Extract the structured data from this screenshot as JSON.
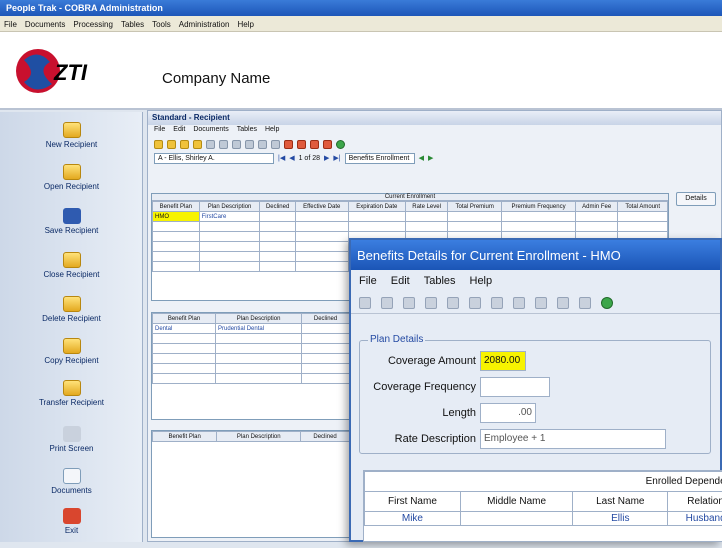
{
  "window": {
    "title": "People Trak - COBRA Administration"
  },
  "menubar": [
    "File",
    "Documents",
    "Processing",
    "Tables",
    "Tools",
    "Administration",
    "Help"
  ],
  "banner": {
    "logo_text": "ZTI",
    "company": "Company Name"
  },
  "sidebar": [
    {
      "label": "New Recipient",
      "icon": "folder-new-icon"
    },
    {
      "label": "Open Recipient",
      "icon": "folder-open-icon"
    },
    {
      "label": "Save Recipient",
      "icon": "save-disk-icon"
    },
    {
      "label": "Close Recipient",
      "icon": "folder-close-icon"
    },
    {
      "label": "Delete Recipient",
      "icon": "folder-delete-icon"
    },
    {
      "label": "Copy Recipient",
      "icon": "folder-copy-icon"
    },
    {
      "label": "Transfer Recipient",
      "icon": "folder-transfer-icon"
    },
    {
      "label": "Print Screen",
      "icon": "printer-icon"
    },
    {
      "label": "Documents",
      "icon": "document-icon"
    },
    {
      "label": "Exit",
      "icon": "exit-icon"
    }
  ],
  "panel": {
    "title": "Standard - Recipient",
    "menu": [
      "File",
      "Edit",
      "Documents",
      "Tables",
      "Help"
    ],
    "recipient_select": "A - Ellis, Shirley A.",
    "nav_label": "1 of 28",
    "view_select": "Benefits Enrollment",
    "details_button": "Details"
  },
  "grid1": {
    "caption": "Current Enrollment",
    "headers": [
      "Benefit Plan",
      "Plan Description",
      "Declined",
      "Effective Date",
      "Expiration Date",
      "Rate Level",
      "Total Premium",
      "Premium Frequency",
      "Admin Fee",
      "Total Amount"
    ],
    "rows": [
      [
        "HMO",
        "FirstCare",
        "",
        "",
        "",
        "",
        "",
        "",
        "",
        ""
      ]
    ]
  },
  "grid2": {
    "headers": [
      "Benefit Plan",
      "Plan Description",
      "Declined"
    ],
    "rows": [
      [
        "Dental",
        "Prudential Dental",
        ""
      ]
    ]
  },
  "grid3": {
    "headers": [
      "Benefit Plan",
      "Plan Description",
      "Declined"
    ]
  },
  "modal": {
    "title": "Benefits Details for Current Enrollment - HMO",
    "menu": [
      "File",
      "Edit",
      "Tables",
      "Help"
    ],
    "plan_details_legend": "Plan Details",
    "coverage_amount_label": "Coverage Amount",
    "coverage_amount": "2080.00",
    "coverage_frequency_label": "Coverage Frequency",
    "coverage_frequency": "",
    "length_label": "Length",
    "length": ".00",
    "rate_description_label": "Rate Description",
    "rate_description": "Employee + 1",
    "dependents_caption": "Enrolled Dependents",
    "dep_headers": [
      "First Name",
      "Middle Name",
      "Last Name",
      "Relation"
    ],
    "dep_rows": [
      [
        "Mike",
        "",
        "Ellis",
        "Husband"
      ]
    ]
  }
}
